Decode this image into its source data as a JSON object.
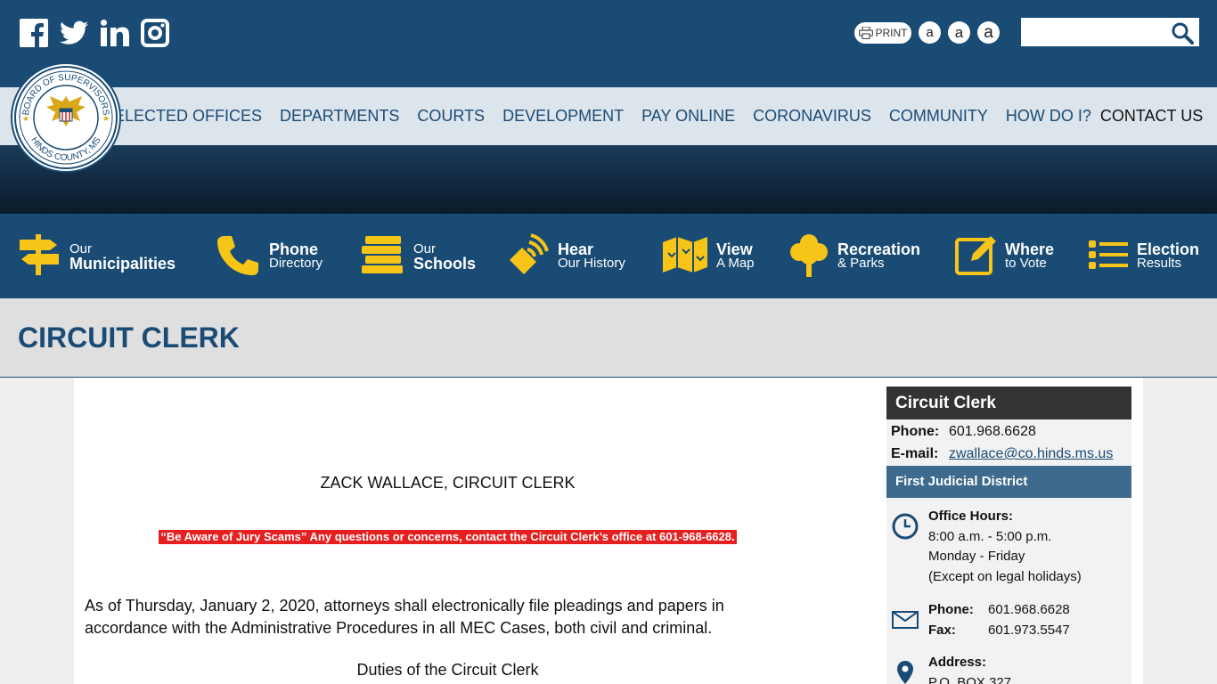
{
  "header": {
    "social": [
      "facebook-icon",
      "twitter-icon",
      "linkedin-icon",
      "instagram-icon"
    ],
    "print_label": "PRINT",
    "font_sizes": [
      "a",
      "a",
      "a"
    ],
    "search_placeholder": ""
  },
  "nav": {
    "items": [
      "ELECTED OFFICES",
      "DEPARTMENTS",
      "COURTS",
      "DEVELOPMENT",
      "PAY ONLINE",
      "CORONAVIRUS",
      "COMMUNITY",
      "HOW DO I?",
      "CONTACT US"
    ]
  },
  "logo": {
    "top_text": "BOARD OF SUPERVISORS",
    "bottom_text": "HINDS COUNTY, MS"
  },
  "quicklinks": [
    {
      "small": "Our",
      "big": "Municipalities",
      "small_first": true
    },
    {
      "big": "Phone",
      "small": "Directory",
      "small_first": false
    },
    {
      "small": "Our",
      "big": "Schools",
      "small_first": true
    },
    {
      "big": "Hear",
      "small": "Our History",
      "small_first": false
    },
    {
      "big": "View",
      "small": "A Map",
      "small_first": false
    },
    {
      "big": "Recreation",
      "small": "& Parks",
      "small_first": false
    },
    {
      "big": "Where",
      "small": "to Vote",
      "small_first": false
    },
    {
      "big": "Election",
      "small": "Results",
      "small_first": false
    }
  ],
  "page_title": "CIRCUIT CLERK",
  "content": {
    "clerk_name": "ZACK WALLACE, CIRCUIT CLERK",
    "alert": "“Be Aware of Jury Scams” Any questions or concerns, contact the Circuit Clerk’s office at 601-968-6628.",
    "notice": "As of Thursday, January 2, 2020, attorneys shall electronically file pleadings and papers in accordance with the Administrative Procedures in all MEC Cases, both civil and criminal.",
    "duties_heading": "Duties of the Circuit Clerk"
  },
  "sidebar": {
    "title": "Circuit Clerk",
    "phone_label": "Phone:",
    "phone": "601.968.6628",
    "email_label": "E-mail:",
    "email": "zwallace@co.hinds.ms.us",
    "district": "First Judicial District",
    "hours_label": "Office Hours:",
    "hours": [
      "8:00 a.m. - 5:00 p.m.",
      "Monday - Friday",
      "(Except on legal holidays)"
    ],
    "contact_phone_label": "Phone:",
    "contact_phone": "601.968.6628",
    "fax_label": "Fax:",
    "fax": "601.973.5547",
    "address_label": "Address:",
    "address_line1": "P.O. BOX 327"
  },
  "colors": {
    "primary": "#1a4b74",
    "accent": "#f6c517",
    "alert": "#e52020",
    "sidebar_head": "#333333",
    "sidebar_sub": "#3d6a8d"
  }
}
